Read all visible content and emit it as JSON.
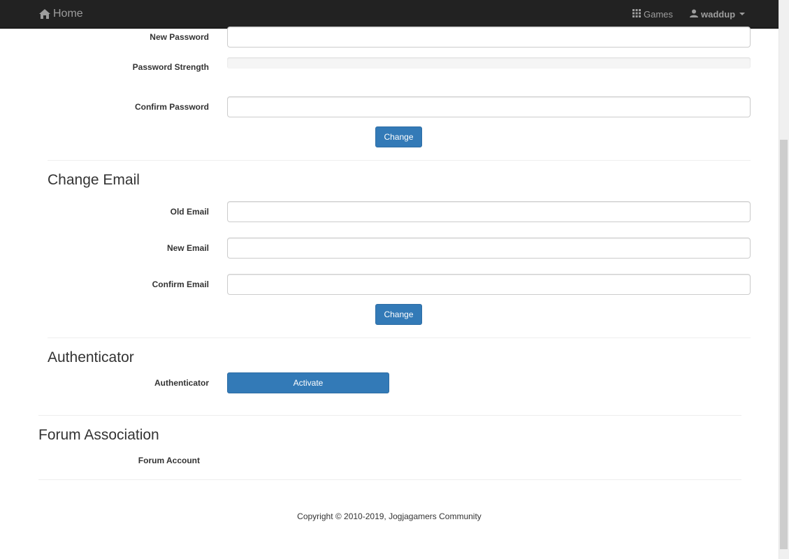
{
  "navbar": {
    "brand_label": "Home",
    "brand_icon": "home-icon",
    "games_label": "Games",
    "games_icon": "grid-icon",
    "user_label": "waddup",
    "user_icon": "user-icon"
  },
  "password_section": {
    "new_password_label": "New Password",
    "strength_label": "Password Strength",
    "confirm_password_label": "Confirm Password",
    "change_button": "Change"
  },
  "email_section": {
    "title": "Change Email",
    "old_email_label": "Old Email",
    "new_email_label": "New Email",
    "confirm_email_label": "Confirm Email",
    "change_button": "Change"
  },
  "authenticator_section": {
    "title": "Authenticator",
    "label": "Authenticator",
    "activate_button": "Activate"
  },
  "forum_section": {
    "title": "Forum Association",
    "account_label": "Forum Account"
  },
  "footer": {
    "copyright": "Copyright © 2010-2019, Jogjagamers Community"
  },
  "colors": {
    "navbar_bg": "#222222",
    "navbar_text": "#9d9d9d",
    "primary": "#337ab7"
  }
}
